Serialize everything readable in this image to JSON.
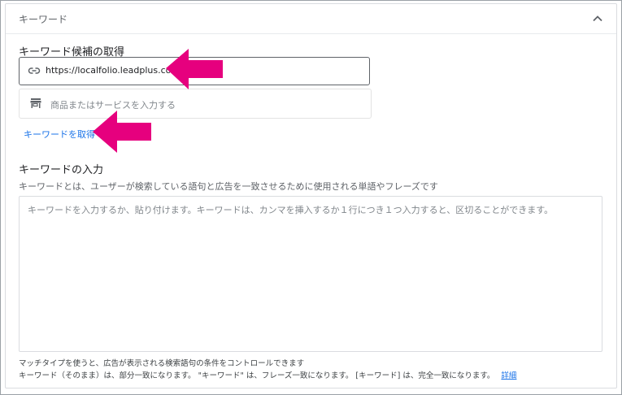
{
  "panel": {
    "title": "キーワード"
  },
  "keyword_sources": {
    "section_title": "キーワード候補の取得",
    "url_value": "https://localfolio.leadplus.co.jp/",
    "product_placeholder": "商品またはサービスを入力する",
    "get_keywords_label": "キーワードを取得"
  },
  "keyword_input": {
    "section_title": "キーワードの入力",
    "description": "キーワードとは、ユーザーが検索している語句と広告を一致させるために使用される単語やフレーズです",
    "placeholder": "キーワードを入力するか、貼り付けます。キーワードは、カンマを挿入するか１行につき１つ入力すると、区切ることができます。"
  },
  "footer": {
    "line1": "マッチタイプを使うと、広告が表示される検索語句の条件をコントロールできます",
    "line2": "キーワード（そのまま）は、部分一致になります。 \"キーワード\" は、フレーズ一致になります。 [キーワード] は、完全一致になります。",
    "details_link": "詳細"
  },
  "colors": {
    "accent": "#1a73e8",
    "annotation_arrow": "#e6007e"
  }
}
